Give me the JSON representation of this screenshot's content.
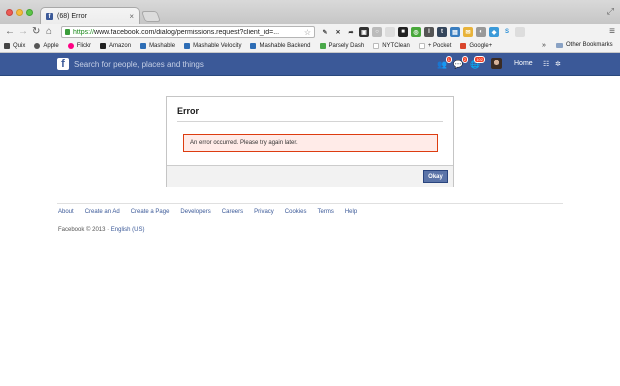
{
  "browser": {
    "tab_title": "(68) Error",
    "tab_close": "×",
    "url_scheme": "https://",
    "url_rest": "www.facebook.com/dialog/permissions.request?client_id=...",
    "bookmarks": [
      {
        "label": "Quix",
        "color": "#444444"
      },
      {
        "label": "Apple",
        "color": "#555555"
      },
      {
        "label": "Flickr",
        "color": "#ff0084"
      },
      {
        "label": "Amazon",
        "color": "#222222"
      },
      {
        "label": "Mashable",
        "color": "#2d6db5"
      },
      {
        "label": "Mashable Velocity",
        "color": "#2d6db5"
      },
      {
        "label": "Mashable Backend",
        "color": "#2d6db5"
      },
      {
        "label": "Parsely Dash",
        "color": "#4aa84a"
      },
      {
        "label": "NYTClean",
        "color": "#dddddd"
      },
      {
        "label": "+ Pocket",
        "color": "#dddddd"
      },
      {
        "label": "Google+",
        "color": "#d9452c"
      }
    ],
    "bookmarks_more": "»",
    "other_bookmarks": "Other Bookmarks"
  },
  "fb_header": {
    "logo": "f",
    "search_placeholder": "Search for people, places and things",
    "friend_requests_badge": "1",
    "messages_badge": "2",
    "notifications_badge": "102",
    "home_label": "Home"
  },
  "dialog": {
    "title": "Error",
    "message": "An error occurred. Please try again later.",
    "okay_label": "Okay"
  },
  "footer": {
    "links": [
      "About",
      "Create an Ad",
      "Create a Page",
      "Developers",
      "Careers",
      "Privacy",
      "Cookies",
      "Terms",
      "Help"
    ],
    "copyright": "Facebook © 2013 · ",
    "language": "English (US)"
  }
}
